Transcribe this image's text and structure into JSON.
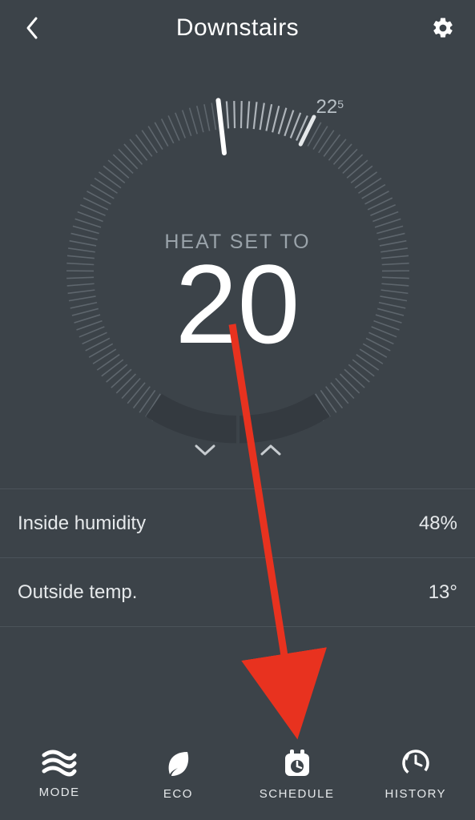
{
  "header": {
    "title": "Downstairs"
  },
  "dial": {
    "mode_label": "HEAT SET TO",
    "setpoint": "20",
    "ambient": "22",
    "ambient_fraction": "5"
  },
  "stats": {
    "humidity_label": "Inside humidity",
    "humidity_value": "48%",
    "outside_label": "Outside temp.",
    "outside_value": "13°"
  },
  "tabs": {
    "mode": "MODE",
    "eco": "ECO",
    "schedule": "SCHEDULE",
    "history": "HISTORY"
  }
}
